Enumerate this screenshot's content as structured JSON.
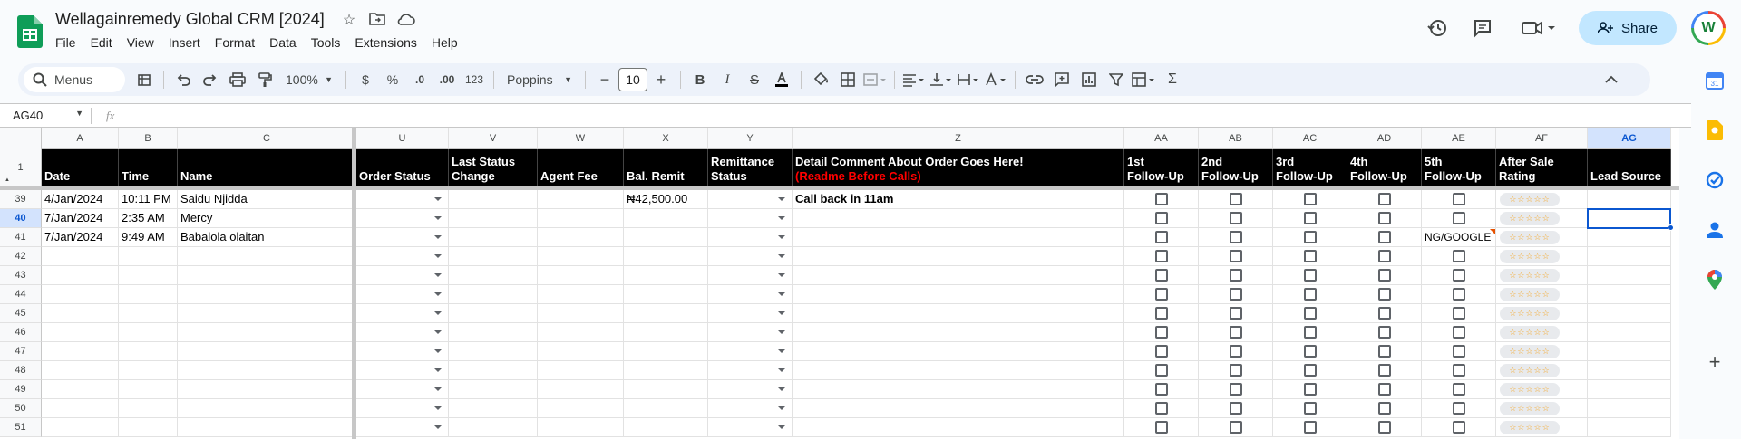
{
  "window": {
    "title": "Wellagainremedy Global CRM [2024]",
    "menus": [
      "File",
      "Edit",
      "View",
      "Insert",
      "Format",
      "Data",
      "Tools",
      "Extensions",
      "Help"
    ],
    "share_label": "Share",
    "avatar_initial": "W"
  },
  "toolbar": {
    "menus_label": "Menus",
    "zoom": "100%",
    "currency": "$",
    "percent": "%",
    "dec_decrease": ".0",
    "dec_increase": ".00",
    "number_format": "123",
    "font": "Poppins",
    "font_size": "10"
  },
  "formula_bar": {
    "cell_ref": "AG40",
    "fx": "fx",
    "value": ""
  },
  "columns": [
    {
      "letter": "A",
      "header": [
        "Date"
      ]
    },
    {
      "letter": "B",
      "header": [
        "Time"
      ]
    },
    {
      "letter": "C",
      "header": [
        "Name"
      ]
    },
    {
      "letter": "U",
      "header": [
        "Order Status"
      ]
    },
    {
      "letter": "V",
      "header": [
        "Last Status",
        "Change"
      ]
    },
    {
      "letter": "W",
      "header": [
        "Agent Fee"
      ]
    },
    {
      "letter": "X",
      "header": [
        "Bal. Remit"
      ]
    },
    {
      "letter": "Y",
      "header": [
        "Remittance",
        "Status"
      ]
    },
    {
      "letter": "Z",
      "header": [
        "Detail Comment About Order Goes Here!",
        "(Readme Before Calls)"
      ]
    },
    {
      "letter": "AA",
      "header": [
        "1st",
        "Follow-Up"
      ]
    },
    {
      "letter": "AB",
      "header": [
        "2nd",
        "Follow-Up"
      ]
    },
    {
      "letter": "AC",
      "header": [
        "3rd",
        "Follow-Up"
      ]
    },
    {
      "letter": "AD",
      "header": [
        "4th",
        "Follow-Up"
      ]
    },
    {
      "letter": "AE",
      "header": [
        "5th",
        "Follow-Up"
      ]
    },
    {
      "letter": "AF",
      "header": [
        "After Sale",
        "Rating"
      ]
    },
    {
      "letter": "AG",
      "header": [
        "Lead Source"
      ]
    }
  ],
  "header_row_number": "1",
  "rows": [
    {
      "num": "39",
      "date": "4/Jan/2024",
      "time": "10:11 PM",
      "name": "Saidu Njidda",
      "bal_remit": "₦42,500.00",
      "comment": "Call back in 11am",
      "fu5_text": ""
    },
    {
      "num": "40",
      "date": "7/Jan/2024",
      "time": "2:35 AM",
      "name": "Mercy",
      "bal_remit": "",
      "comment": "",
      "fu5_text": ""
    },
    {
      "num": "41",
      "date": "7/Jan/2024",
      "time": "9:49 AM",
      "name": "Babalola olaitan",
      "bal_remit": "",
      "comment": "",
      "fu5_text": "NG/GOOGLE"
    },
    {
      "num": "42",
      "date": "",
      "time": "",
      "name": "",
      "bal_remit": "",
      "comment": "",
      "fu5_text": ""
    },
    {
      "num": "43",
      "date": "",
      "time": "",
      "name": "",
      "bal_remit": "",
      "comment": "",
      "fu5_text": ""
    },
    {
      "num": "44",
      "date": "",
      "time": "",
      "name": "",
      "bal_remit": "",
      "comment": "",
      "fu5_text": ""
    },
    {
      "num": "45",
      "date": "",
      "time": "",
      "name": "",
      "bal_remit": "",
      "comment": "",
      "fu5_text": ""
    },
    {
      "num": "46",
      "date": "",
      "time": "",
      "name": "",
      "bal_remit": "",
      "comment": "",
      "fu5_text": ""
    },
    {
      "num": "47",
      "date": "",
      "time": "",
      "name": "",
      "bal_remit": "",
      "comment": "",
      "fu5_text": ""
    },
    {
      "num": "48",
      "date": "",
      "time": "",
      "name": "",
      "bal_remit": "",
      "comment": "",
      "fu5_text": ""
    },
    {
      "num": "49",
      "date": "",
      "time": "",
      "name": "",
      "bal_remit": "",
      "comment": "",
      "fu5_text": ""
    },
    {
      "num": "50",
      "date": "",
      "time": "",
      "name": "",
      "bal_remit": "",
      "comment": "",
      "fu5_text": ""
    },
    {
      "num": "51",
      "date": "",
      "time": "",
      "name": "",
      "bal_remit": "",
      "comment": "",
      "fu5_text": ""
    }
  ],
  "rating_stars": "☆☆☆☆☆",
  "selected_cell": {
    "column": "AG",
    "row": "40"
  },
  "colors": {
    "accent": "#0b57d0",
    "header_bg": "#000000",
    "header_text": "#ffffff",
    "readme_red": "#ff0000",
    "share_bg": "#c2e7ff",
    "sheets_green": "#0f9d58"
  },
  "side_panel_icons": [
    "calendar-icon",
    "keep-icon",
    "tasks-icon",
    "contacts-icon",
    "maps-icon",
    "add-icon"
  ]
}
